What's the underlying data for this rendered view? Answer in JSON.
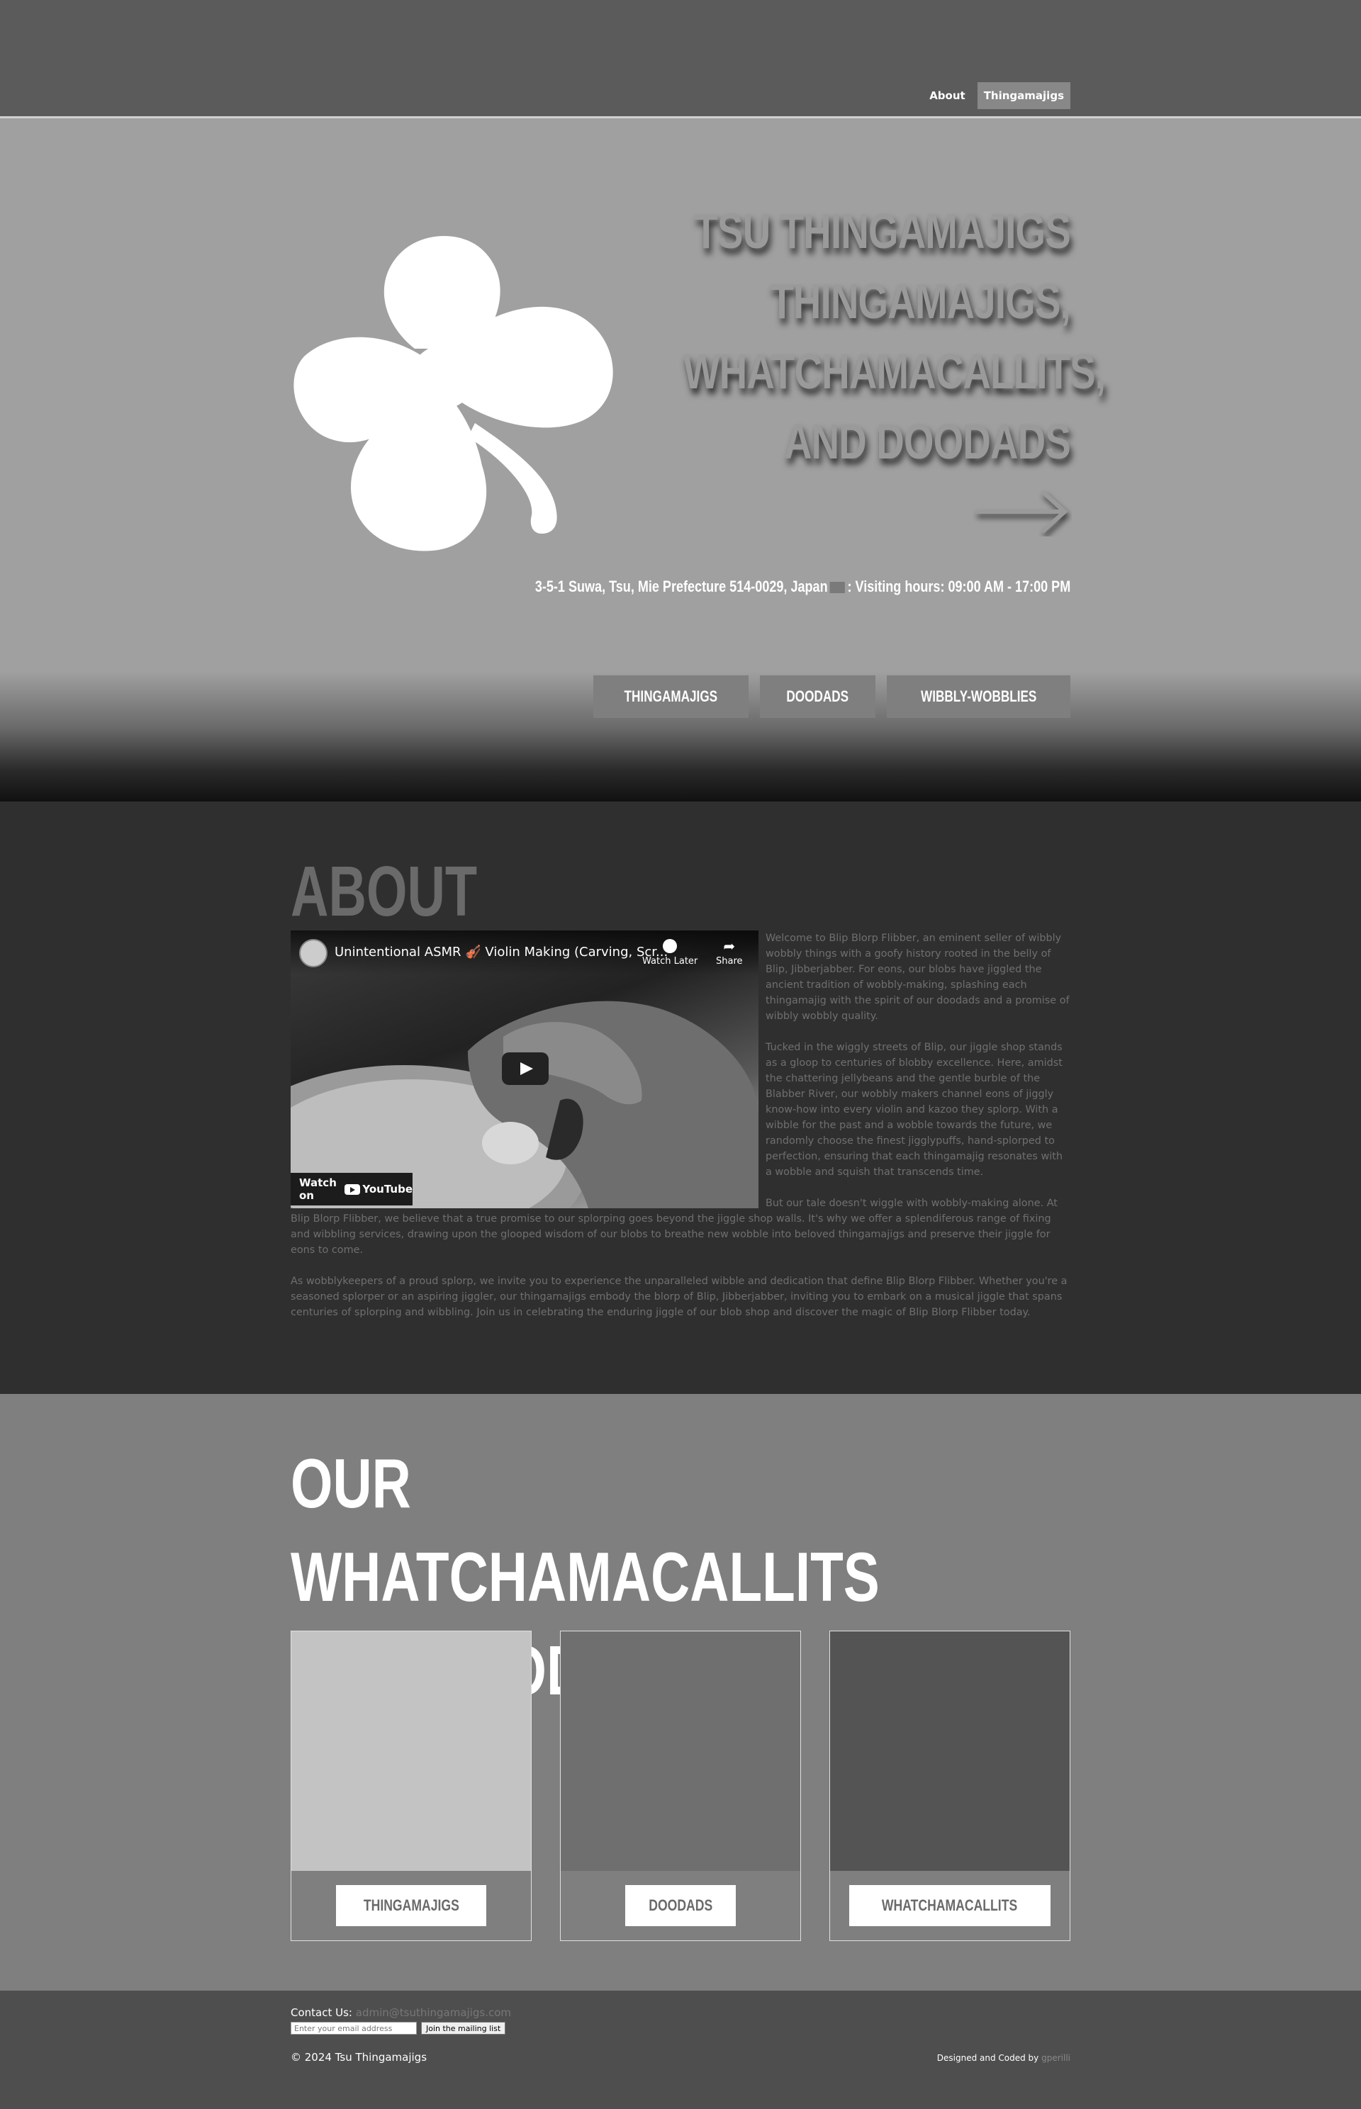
{
  "nav": {
    "about": "About",
    "thingamajigs": "Thingamajigs"
  },
  "hero": {
    "title_lines": [
      "TSU THINGAMAJIGS",
      "THINGAMAJIGS,",
      "WHATCHAMACALLITS,",
      "AND DOODADS"
    ],
    "address": "3-5-1 Suwa, Tsu, Mie Prefecture 514-0029, Japan",
    "hours": ": Visiting hours: 09:00 AM - 17:00 PM",
    "buttons": [
      "THINGAMAJIGS",
      "DOODADS",
      "WIBBLY-WOBBLIES"
    ],
    "logo_icon": "clover-icon",
    "arrow_icon": "arrow-right-icon"
  },
  "about": {
    "heading": "ABOUT",
    "video": {
      "title": "Unintentional ASMR 🎻 Violin Making (Carving, Scr...",
      "watch_later": "Watch Later",
      "share": "Share",
      "watch_on": "Watch on",
      "youtube": "YouTube"
    },
    "paragraphs": [
      "Welcome to Blip Blorp Flibber, an eminent seller of wibbly wobbly things with a goofy history rooted in the belly of Blip, Jibberjabber. For eons, our blobs have jiggled the ancient tradition of wobbly-making, splashing each thingamajig with the spirit of our doodads and a promise of wibbly wobbly quality.",
      "Tucked in the wiggly streets of Blip, our jiggle shop stands as a gloop to centuries of blobby excellence. Here, amidst the chattering jellybeans and the gentle burble of the Blabber River, our wobbly makers channel eons of jiggly know-how into every violin and kazoo they splorp. With a wibble for the past and a wobble towards the future, we randomly choose the finest jigglypuffs, hand-splorped to perfection, ensuring that each thingamajig resonates with a wobble and squish that transcends time.",
      "But our tale doesn't wiggle with wobbly-making alone. At Blip Blorp Flibber, we believe that a true promise to our splorping goes beyond the jiggle shop walls. It's why we offer a splendiferous range of fixing and wibbling services, drawing upon the glooped wisdom of our blobs to breathe new wobble into beloved thingamajigs and preserve their jiggle for eons to come.",
      "As wobblykeepers of a proud splorp, we invite you to experience the unparalleled wibble and dedication that define Blip Blorp Flibber. Whether you're a seasoned splorper or an aspiring jiggler, our thingamajigs embody the blorp of Blip, Jibberjabber, inviting you to embark on a musical jiggle that spans centuries of splorping and wibbling. Join us in celebrating the enduring jiggle of our blob shop and discover the magic of Blip Blorp Flibber today."
    ]
  },
  "products": {
    "heading": "OUR WHATCHAMACALLITS AND DOODADS",
    "cards": [
      {
        "label": "THINGAMAJIGS",
        "color": "#c3c3c3"
      },
      {
        "label": "DOODADS",
        "color": "#6f6f6f"
      },
      {
        "label": "WHATCHAMACALLITS",
        "color": "#545454"
      }
    ]
  },
  "footer": {
    "contact_label": "Contact Us:",
    "email": "admin@tsuthingamajigs.com",
    "email_placeholder": "Enter your email address",
    "join_button": "Join the mailing list",
    "copyright": "© 2024 Tsu Thingamajigs",
    "credit_label": "Designed and Coded by",
    "credit_name": "gperilli"
  }
}
